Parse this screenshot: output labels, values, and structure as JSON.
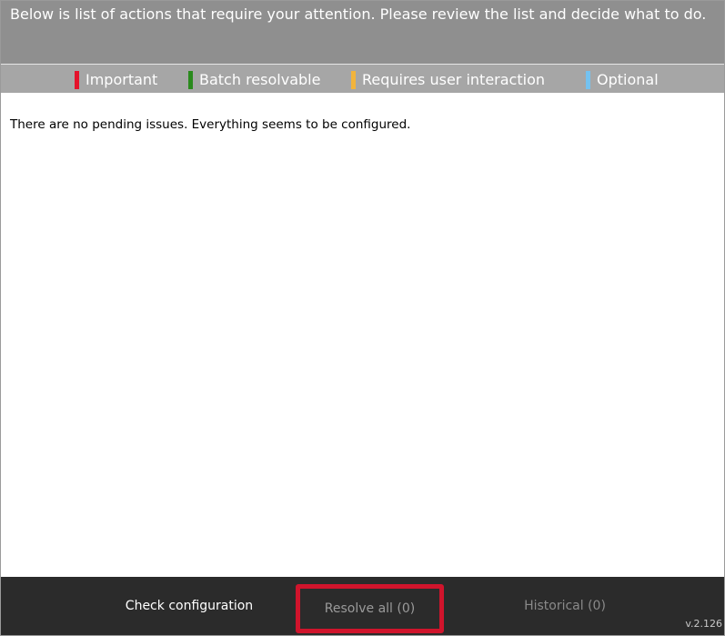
{
  "header": {
    "message": "Below is list of actions that require your attention. Please review the list and decide what to do."
  },
  "legend": {
    "items": [
      {
        "label": "Important",
        "color": "#e4122b"
      },
      {
        "label": "Batch resolvable",
        "color": "#2a8a1d"
      },
      {
        "label": "Requires user interaction",
        "color": "#f2b43c"
      },
      {
        "label": "Optional",
        "color": "#74c2f0"
      }
    ]
  },
  "content": {
    "status_message": "There are no pending issues. Everything seems to be configured."
  },
  "footer": {
    "check_label": "Check configuration",
    "resolve_label": "Resolve all (0)",
    "historical_label": "Historical (0)",
    "highlight_color": "#d0142c",
    "version": "v.2.126"
  }
}
